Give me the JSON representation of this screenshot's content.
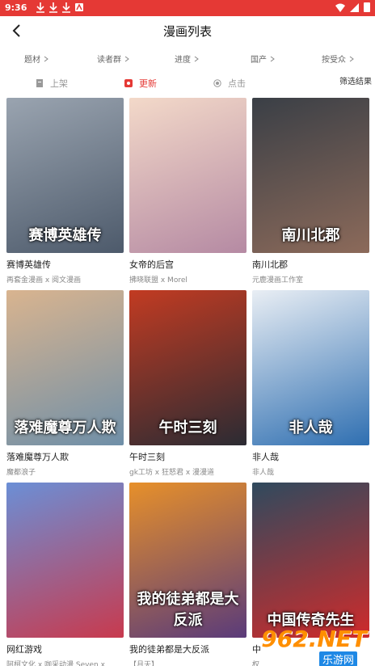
{
  "status": {
    "time": "9:36"
  },
  "header": {
    "title": "漫画列表"
  },
  "filters": [
    "题材",
    "读者群",
    "进度",
    "国产",
    "按受众"
  ],
  "sort": {
    "options": [
      "上架",
      "更新",
      "点击"
    ],
    "active_index": 1,
    "result_label": "筛选结果"
  },
  "accent_color": "#e53935",
  "comics": [
    {
      "name": "赛博英雄传",
      "author": "再套金漫画 x 阅文漫画",
      "cover_text": "赛博英雄传",
      "palette": [
        "#9aa4b0",
        "#4d5a6b"
      ]
    },
    {
      "name": "女帝的后宫",
      "author": "拂晓联盟 x Morel",
      "cover_text": "",
      "palette": [
        "#f3d9c9",
        "#b58aa3"
      ]
    },
    {
      "name": "南川北郡",
      "author": "元鹿漫画工作室",
      "cover_text": "南川北郡",
      "palette": [
        "#3a3f46",
        "#8c6a5a"
      ]
    },
    {
      "name": "落难魔尊万人欺",
      "author": "魔都浪子",
      "cover_text": "落难魔尊万人欺",
      "palette": [
        "#d9b48f",
        "#6f8fa8"
      ]
    },
    {
      "name": "午时三刻",
      "author": "gk工坊 x 狂怒君 x 漫漫道",
      "cover_text": "午时三刻",
      "palette": [
        "#c23b22",
        "#2b2b33"
      ]
    },
    {
      "name": "非人哉",
      "author": "非人哉",
      "cover_text": "非人哉",
      "palette": [
        "#e9eef4",
        "#2f6fb1"
      ]
    },
    {
      "name": "网红游戏",
      "author": "阿柯文化 x 咖采动漫 Seven x",
      "cover_text": "",
      "palette": [
        "#6b8fd6",
        "#c83a4e"
      ]
    },
    {
      "name": "我的徒弟都是大反派",
      "author": "【月天】",
      "cover_text": "我的徒弟都是大反派",
      "palette": [
        "#e7902a",
        "#5a3b7a"
      ]
    },
    {
      "name": "中",
      "author": "权",
      "cover_text": "中国传奇先生",
      "palette": [
        "#2f4a5e",
        "#cf2b2b"
      ]
    }
  ],
  "watermark": {
    "top": "962.NET",
    "bottom": "乐游网"
  }
}
